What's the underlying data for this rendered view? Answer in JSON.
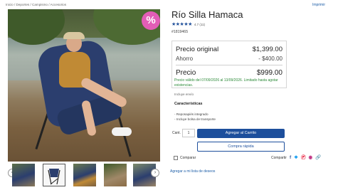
{
  "breadcrumb": "Inicio / Deportes / Campismo / Accesorios",
  "print_label": "Imprimir",
  "discount_badge": "%",
  "product": {
    "title": "Río Silla Hamaca",
    "stars": "★★★★★",
    "rating_text": "4.7 (11)",
    "sku": "#1819465"
  },
  "prices": {
    "original_label": "Precio original",
    "original_value": "$1,399.00",
    "savings_label": "Ahorro",
    "savings_value": "- $400.00",
    "price_label": "Precio",
    "price_value": "$999.00"
  },
  "validity_text": "Precio válido del 07/09/2026 al 13/09/2026. Limitado hasta agotar existencias.",
  "shipping_text": "Incluye envío",
  "features": {
    "title": "Características",
    "items": [
      "- Reposapiés integrado",
      "- Incluye bolsa de transporte"
    ]
  },
  "purchase": {
    "qty_label": "Cant.",
    "qty_value": "1",
    "add_to_cart": "Agregar al Carrito",
    "quick_buy": "Compra rápida"
  },
  "compare_label": "Comparar",
  "share": {
    "label": "Compartir",
    "icons": [
      "facebook-icon",
      "twitter-icon",
      "pinterest-icon",
      "instagram-icon",
      "link-icon"
    ]
  },
  "wishlist_label": "Agregar a mi lista de deseos",
  "colors": {
    "accent": "#1d4f9c",
    "badge": "#e25db6",
    "validity": "#2e8b3a"
  }
}
